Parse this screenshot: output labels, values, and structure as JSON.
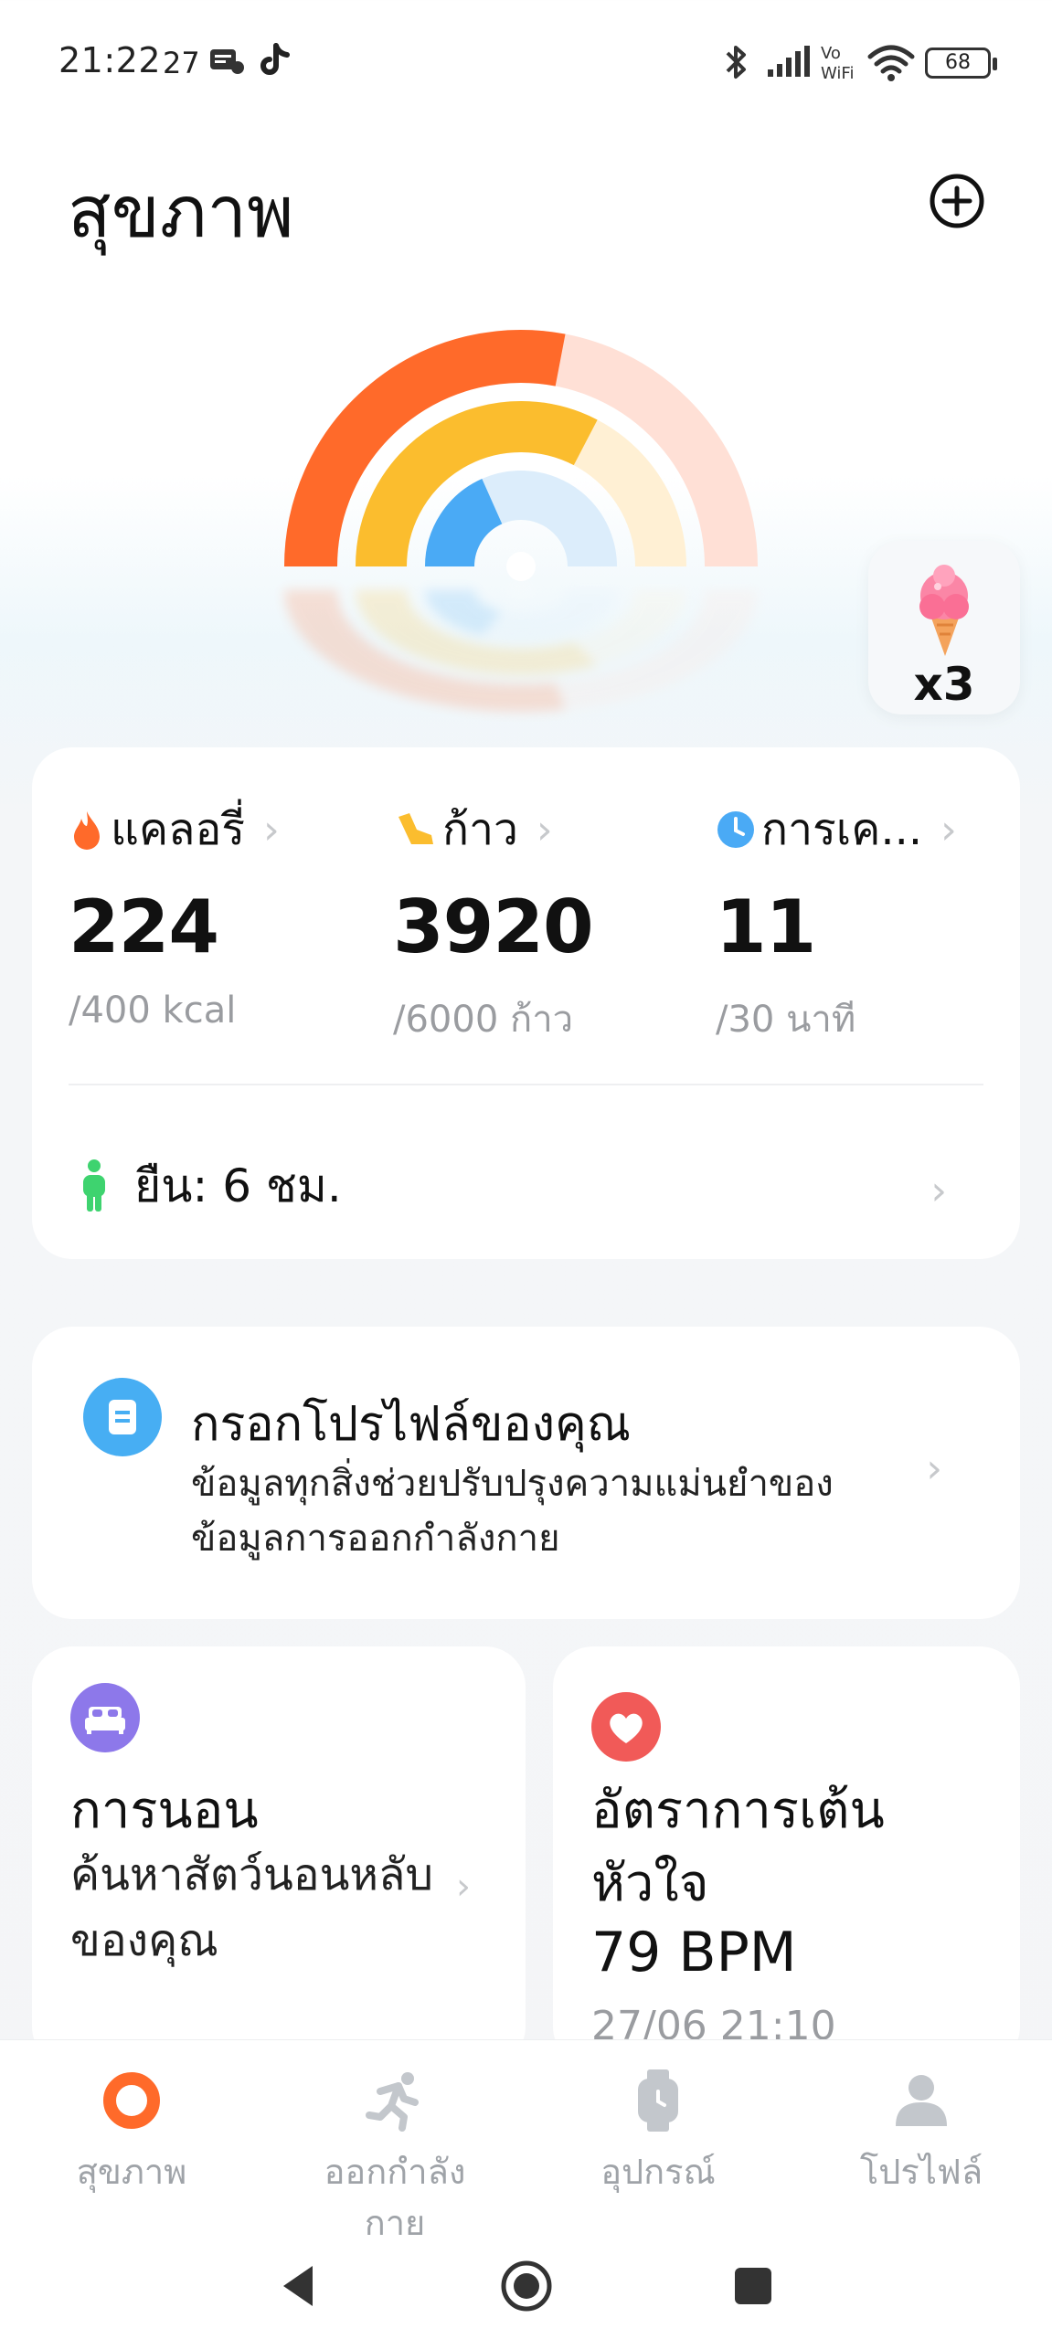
{
  "status_bar": {
    "time": "21:22",
    "extra": "27",
    "battery": "68"
  },
  "header": {
    "title": "สุขภาพ"
  },
  "colors": {
    "calories": "#ff6a2a",
    "steps": "#fbbd2e",
    "exercise": "#4aaaf5",
    "stand": "#3ed36f",
    "sleep": "#8d78ea",
    "heart": "#f15a58",
    "profile": "#47aef3",
    "accent": "#ff6a2a"
  },
  "rings": {
    "calories_fraction": 0.56,
    "steps_fraction": 0.653,
    "exercise_fraction": 0.367
  },
  "badge": {
    "icon": "ice-cream-icon",
    "count": "x3"
  },
  "activity": {
    "calories": {
      "label": "แคลอรี่",
      "value": "224",
      "goal": "/400 kcal"
    },
    "steps": {
      "label": "ก้าว",
      "value": "3920",
      "goal": "/6000 ก้าว"
    },
    "exercise": {
      "label": "การเค...",
      "value": "11",
      "goal": "/30 นาที"
    },
    "stand": {
      "label": "ยืน: 6 ชม."
    }
  },
  "profile_card": {
    "title": "กรอกโปรไฟล์ของคุณ",
    "description": "ข้อมูลทุกสิ่งช่วยปรับปรุงความแม่นยำของข้อมูลการออกกำลังกาย"
  },
  "sleep_card": {
    "title": "การนอน",
    "subtitle_line1": "ค้นหาสัตว์นอนหลับ",
    "subtitle_line2": "ของคุณ"
  },
  "heart_card": {
    "title_line1": "อัตราการเต้น",
    "title_line2": "หัวใจ",
    "value": "79 BPM",
    "time": "27/06 21:10"
  },
  "bottom_nav": {
    "health": "สุขภาพ",
    "workout_line1": "ออกกำลัง",
    "workout_line2": "กาย",
    "devices": "อุปกรณ์",
    "profile": "โปรไฟล์"
  }
}
